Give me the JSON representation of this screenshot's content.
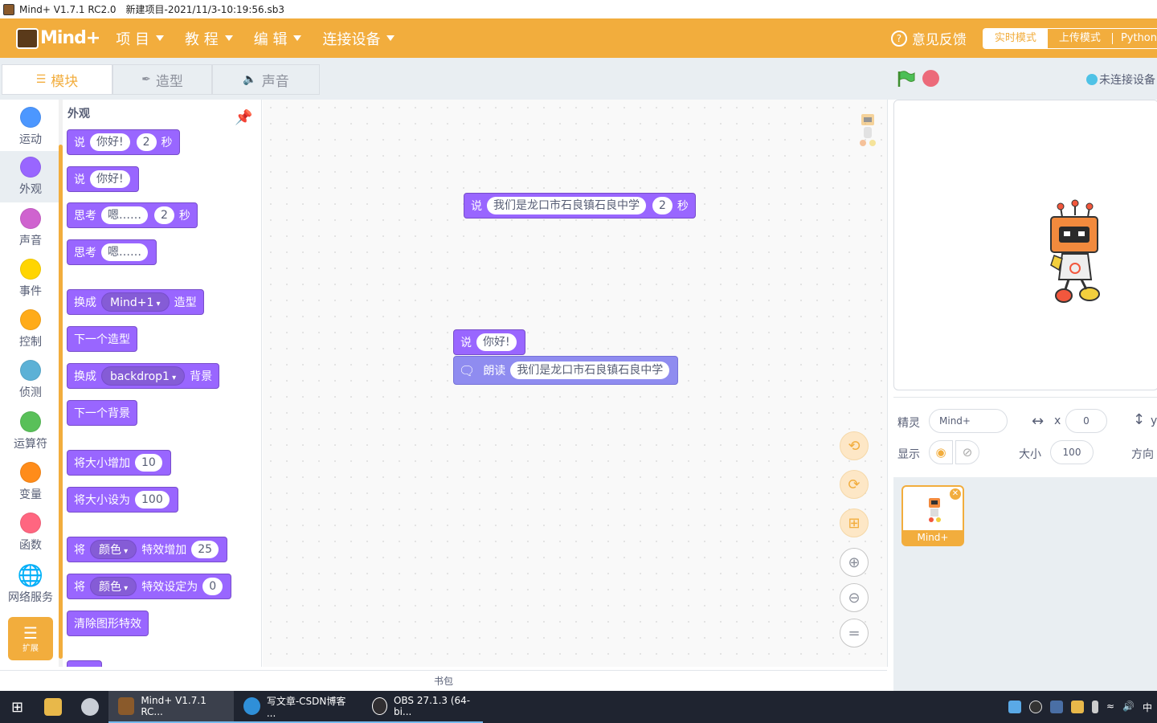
{
  "window": {
    "app_name": "Mind+ V1.7.1 RC2.0",
    "file_name": "新建项目-2021/11/3-10:19:56.sb3"
  },
  "menubar": {
    "logo_text": "Mind+",
    "items": [
      "项 目",
      "教 程",
      "编 辑",
      "连接设备"
    ],
    "feedback": "意见反馈",
    "modes": [
      "实时模式",
      "上传模式",
      "Python"
    ]
  },
  "tabs": [
    "模块",
    "造型",
    "声音"
  ],
  "connection_status": "未连接设备",
  "categories": [
    {
      "label": "运动",
      "color": "#4c97ff"
    },
    {
      "label": "外观",
      "color": "#9966ff"
    },
    {
      "label": "声音",
      "color": "#cf63cf"
    },
    {
      "label": "事件",
      "color": "#ffd500"
    },
    {
      "label": "控制",
      "color": "#ffab19"
    },
    {
      "label": "侦测",
      "color": "#5cb1d6"
    },
    {
      "label": "运算符",
      "color": "#59c059"
    },
    {
      "label": "变量",
      "color": "#ff8c1a"
    },
    {
      "label": "函数",
      "color": "#ff6680"
    },
    {
      "label": "网络服务",
      "color": "#4c97ff"
    }
  ],
  "extension_label": "扩展",
  "palette": {
    "title": "外观",
    "blocks": {
      "say_secs": {
        "a": "说",
        "msg": "你好!",
        "secs": "2",
        "unit": "秒"
      },
      "say": {
        "a": "说",
        "msg": "你好!"
      },
      "think_secs": {
        "a": "思考",
        "msg": "嗯……",
        "secs": "2",
        "unit": "秒"
      },
      "think": {
        "a": "思考",
        "msg": "嗯……"
      },
      "switch_costume": {
        "a": "换成",
        "opt": "Mind+1",
        "b": "造型"
      },
      "next_costume": "下一个造型",
      "switch_backdrop": {
        "a": "换成",
        "opt": "backdrop1",
        "b": "背景"
      },
      "next_backdrop": "下一个背景",
      "change_size": {
        "a": "将大小增加",
        "val": "10"
      },
      "set_size": {
        "a": "将大小设为",
        "val": "100"
      },
      "change_effect": {
        "a": "将",
        "opt": "颜色",
        "b": "特效增加",
        "val": "25"
      },
      "set_effect": {
        "a": "将",
        "opt": "颜色",
        "b": "特效设定为",
        "val": "0"
      },
      "clear_effects": "清除图形特效"
    }
  },
  "script": {
    "block1": {
      "a": "说",
      "msg": "我们是龙口市石良镇石良中学",
      "secs": "2",
      "unit": "秒"
    },
    "block2": {
      "a": "说",
      "msg": "你好!"
    },
    "block3": {
      "a": "朗读",
      "msg": "我们是龙口市石良镇石良中学"
    }
  },
  "backpack_label": "书包",
  "sprite_info": {
    "sprite_label": "精灵",
    "sprite_name": "Mind+",
    "x_label": "x",
    "x_value": "0",
    "y_label": "y",
    "show_label": "显示",
    "size_label": "大小",
    "size_value": "100",
    "direction_label": "方向"
  },
  "sprite_card_name": "Mind+",
  "taskbar": {
    "items": [
      "Mind+ V1.7.1 RC...",
      "写文章-CSDN博客 ...",
      "OBS 27.1.3 (64-bi..."
    ],
    "ime": "中"
  }
}
